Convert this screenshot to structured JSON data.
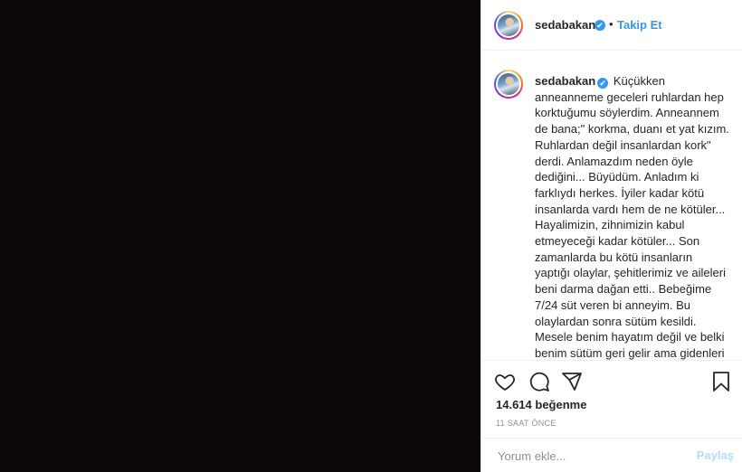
{
  "post": {
    "username": "sedabakan",
    "verified_symbol": "✔",
    "separator": "•",
    "follow_label": "Takip Et",
    "more_label": "...",
    "caption": "Küçükken anneanneme geceleri ruhlardan hep korktuğumu söylerdim. Anneannem de bana;\" korkma, duanı et yat kızım. Ruhlardan değil insanlardan kork\" derdi. Anlamazdım neden öyle dediğini... Büyüdüm. Anladım ki farklıydı herkes. İyiler kadar kötü insanlarda vardı hem de ne kötüler... Hayalimizin, zihnimizin kabul etmeyeceği kadar kötüler... Son zamanlarda bu kötü insanların yaptığı olaylar, şehitlerimiz ve aileleri beni darma dağan etti.. Bebeğime 7/24 süt veren bi anneyim. Bu olaylardan sonra sütüm kesildi. Mesele benim hayatım değil ve belki benim sütüm geri gelir ama gidenleri kimse geri getiremez! Dağılan aileleri kimse geri toplayamaz... Ve son olarak az önce izlediğim mülteci kardeşlerimizin",
    "likes": "14.614 beğenme",
    "timestamp": "11 SAAT ÖNCE",
    "comment_placeholder": "Yorum ekle...",
    "share_label": "Paylaş"
  },
  "colors": {
    "media_background": "#0c0606",
    "accent": "#3897f0",
    "share_disabled": "#b2dffc"
  },
  "icons": [
    "heart-icon",
    "comment-icon",
    "share-icon",
    "bookmark-icon"
  ]
}
